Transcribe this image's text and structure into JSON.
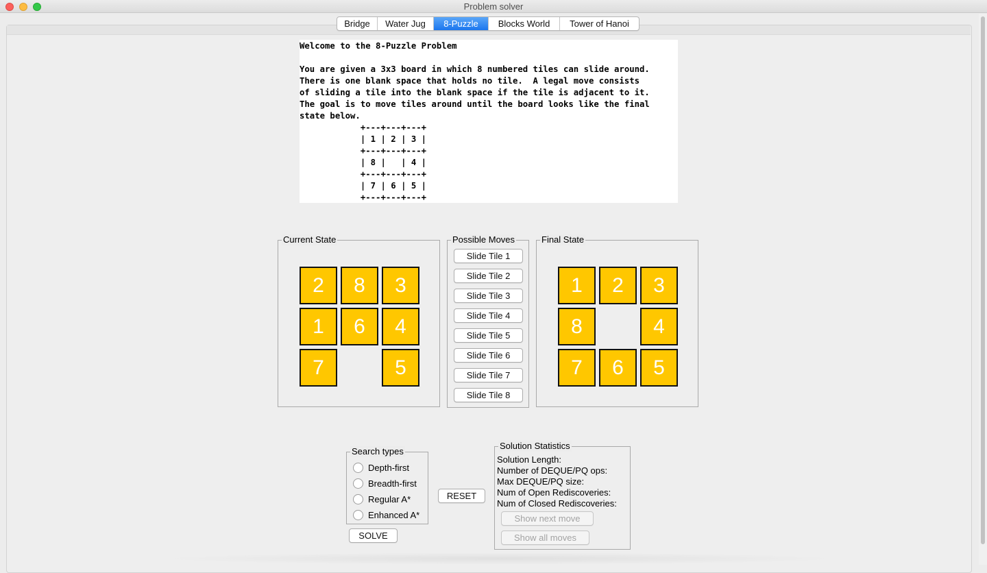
{
  "window": {
    "title": "Problem solver",
    "accent": "#1b76ee"
  },
  "tabs": [
    {
      "label": "Bridge"
    },
    {
      "label": "Water Jug"
    },
    {
      "label": "8-Puzzle",
      "active": true
    },
    {
      "label": "Blocks World"
    },
    {
      "label": "Tower of Hanoi"
    }
  ],
  "intro": {
    "text": "Welcome to the 8-Puzzle Problem\n\nYou are given a 3x3 board in which 8 numbered tiles can slide around.\nThere is one blank space that holds no tile.  A legal move consists\nof sliding a tile into the blank space if the tile is adjacent to it.\nThe goal is to move tiles around until the board looks like the final\nstate below.\n            +---+---+---+\n            | 1 | 2 | 3 |\n            +---+---+---+\n            | 8 |   | 4 |\n            +---+---+---+\n            | 7 | 6 | 5 |\n            +---+---+---+"
  },
  "current_state": {
    "title": "Current State",
    "tiles": [
      "2",
      "8",
      "3",
      "1",
      "6",
      "4",
      "7",
      "",
      "5"
    ]
  },
  "possible_moves": {
    "title": "Possible Moves",
    "buttons": [
      "Slide Tile 1",
      "Slide Tile 2",
      "Slide Tile 3",
      "Slide Tile 4",
      "Slide Tile 5",
      "Slide Tile 6",
      "Slide Tile 7",
      "Slide Tile 8"
    ]
  },
  "final_state": {
    "title": "Final State",
    "tiles": [
      "1",
      "2",
      "3",
      "8",
      "",
      "4",
      "7",
      "6",
      "5"
    ]
  },
  "tile_color": "#ffc700",
  "search_types": {
    "title": "Search types",
    "options": [
      "Depth-first",
      "Breadth-first",
      "Regular A*",
      "Enhanced A*"
    ]
  },
  "buttons": {
    "solve": "SOLVE",
    "reset": "RESET"
  },
  "solution_statistics": {
    "title": "Solution Statistics",
    "lines": [
      "Solution Length:",
      "Number of DEQUE/PQ ops:",
      "Max DEQUE/PQ size:",
      "Num of Open Rediscoveries:",
      "Num of Closed Rediscoveries:"
    ],
    "show_next": "Show next move",
    "show_all": "Show all moves"
  }
}
